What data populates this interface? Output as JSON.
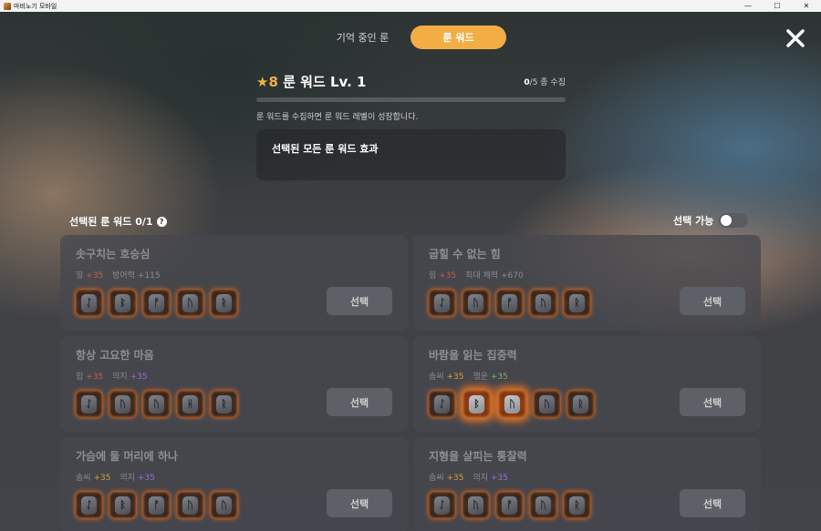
{
  "window": {
    "title": "마비노기 모바일",
    "minimize": "—",
    "maximize": "☐",
    "close": "✕"
  },
  "tabs": [
    {
      "label": "기억 중인 룬",
      "active": false
    },
    {
      "label": "룬 워드",
      "active": true
    }
  ],
  "level": {
    "star": "★",
    "star_count": "8",
    "title": "룬 워드 Lv. 1",
    "collected": "0",
    "total_text": "/5 종 수집",
    "progress_fraction": 0,
    "hint": "룬 워드를 수집하면 룬 워드 레벨이 성장합니다.",
    "effect_title": "선택된 모든 룬 워드 효과"
  },
  "selected_header": {
    "label": "선택된 룬 워드 0/1",
    "help": "?"
  },
  "toggle": {
    "label": "선택 가능",
    "on": false
  },
  "colors": {
    "accent": "#f2ae45",
    "rune_glow": "#ff7a1c"
  },
  "cards": [
    {
      "name": "솟구치는 호승심",
      "stats": [
        {
          "label": "힘",
          "value": "+35",
          "tone": "red"
        },
        {
          "label": "방어력",
          "value": "+115",
          "tone": "plain"
        }
      ],
      "runes": [
        {
          "glyph": "ᛇ",
          "glow": false
        },
        {
          "glyph": "ᛒ",
          "glow": false
        },
        {
          "glyph": "ᚡ",
          "glow": false
        },
        {
          "glyph": "ᚢ",
          "glow": false
        },
        {
          "glyph": "ᚱ",
          "glow": false
        }
      ],
      "button": "선택"
    },
    {
      "name": "굽힐 수 없는 힘",
      "stats": [
        {
          "label": "힘",
          "value": "+35",
          "tone": "red"
        },
        {
          "label": "최대 체력",
          "value": "+670",
          "tone": "plain"
        }
      ],
      "runes": [
        {
          "glyph": "ᛇ",
          "glow": false
        },
        {
          "glyph": "ᚢ",
          "glow": false
        },
        {
          "glyph": "ᚡ",
          "glow": false
        },
        {
          "glyph": "ᚢ",
          "glow": false
        },
        {
          "glyph": "ᚱ",
          "glow": false
        }
      ],
      "button": "선택"
    },
    {
      "name": "항상 고요한 마음",
      "stats": [
        {
          "label": "힘",
          "value": "+35",
          "tone": "red"
        },
        {
          "label": "의지",
          "value": "+35",
          "tone": "purple"
        }
      ],
      "runes": [
        {
          "glyph": "ᛇ",
          "glow": false
        },
        {
          "glyph": "ᚢ",
          "glow": false
        },
        {
          "glyph": "ᚢ",
          "glow": false
        },
        {
          "glyph": "ᚺ",
          "glow": false
        },
        {
          "glyph": "ᚱ",
          "glow": false
        }
      ],
      "button": "선택"
    },
    {
      "name": "바람을 읽는 집중력",
      "stats": [
        {
          "label": "솜씨",
          "value": "+35",
          "tone": "gold"
        },
        {
          "label": "행운",
          "value": "+35",
          "tone": "green"
        }
      ],
      "runes": [
        {
          "glyph": "ᛇ",
          "glow": false
        },
        {
          "glyph": "ᛒ",
          "glow": true
        },
        {
          "glyph": "ᚢ",
          "glow": true
        },
        {
          "glyph": "ᚢ",
          "glow": false
        },
        {
          "glyph": "ᚱ",
          "glow": false
        }
      ],
      "button": "선택"
    },
    {
      "name": "가슴에 둘 머리에 하나",
      "stats": [
        {
          "label": "솜씨",
          "value": "+35",
          "tone": "gold"
        },
        {
          "label": "의지",
          "value": "+35",
          "tone": "purple"
        }
      ],
      "runes": [
        {
          "glyph": "ᛇ",
          "glow": false
        },
        {
          "glyph": "ᛒ",
          "glow": false
        },
        {
          "glyph": "ᚡ",
          "glow": false
        },
        {
          "glyph": "ᚢ",
          "glow": false
        },
        {
          "glyph": "ᚢ",
          "glow": false
        }
      ],
      "button": "선택"
    },
    {
      "name": "지형을 살피는 통찰력",
      "stats": [
        {
          "label": "솜씨",
          "value": "+35",
          "tone": "gold"
        },
        {
          "label": "의지",
          "value": "+35",
          "tone": "purple"
        }
      ],
      "runes": [
        {
          "glyph": "ᛇ",
          "glow": false
        },
        {
          "glyph": "ᚢ",
          "glow": false
        },
        {
          "glyph": "ᚡ",
          "glow": false
        },
        {
          "glyph": "ᚢ",
          "glow": false
        },
        {
          "glyph": "ᚱ",
          "glow": false
        }
      ],
      "button": "선택"
    }
  ]
}
